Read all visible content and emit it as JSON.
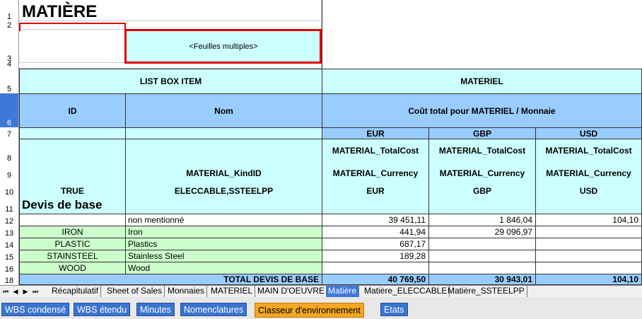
{
  "sheet": {
    "title": "MATIÈRE",
    "multi_sheets": "<Feuilles multiples>",
    "header_list_box": "LIST BOX ITEM",
    "header_materiel": "MATERIEL",
    "col_id": "ID",
    "col_nom": "Nom",
    "col_cost": "Coût total pour MATERIEL / Monnaie",
    "currencies": [
      "EUR",
      "GBP",
      "USD"
    ],
    "row8_fields": [
      "MATERIAL_TotalCost",
      "MATERIAL_TotalCost",
      "MATERIAL_TotalCost"
    ],
    "row9_kind": "MATERIAL_KindID",
    "row9_fields": [
      "MATERIAL_Currency",
      "MATERIAL_Currency",
      "MATERIAL_Currency"
    ],
    "row10": {
      "id": "TRUE",
      "nom": "ELECCABLE,SSTEELPP",
      "currencies": [
        "EUR",
        "GBP",
        "USD"
      ]
    },
    "section": "Devis de base",
    "rows": [
      {
        "id": "",
        "nom": "non mentionné",
        "eur": "39 451,11",
        "gbp": "1 846,04",
        "usd": "104,10"
      },
      {
        "id": "IRON",
        "nom": "Iron",
        "eur": "441,94",
        "gbp": "29 096,97",
        "usd": ""
      },
      {
        "id": "PLASTIC",
        "nom": "Plastics",
        "eur": "687,17",
        "gbp": "",
        "usd": ""
      },
      {
        "id": "STAINSTEEL",
        "nom": "Stainless Steel",
        "eur": "189,28",
        "gbp": "",
        "usd": ""
      },
      {
        "id": "WOOD",
        "nom": "Wood",
        "eur": "",
        "gbp": "",
        "usd": ""
      }
    ],
    "total": {
      "label": "TOTAL DEVIS DE BASE",
      "eur": "40 769,50",
      "gbp": "30 943,01",
      "usd": "104,10"
    },
    "row_numbers": [
      "1",
      "2",
      "3",
      "4",
      "5",
      "6",
      "7",
      "8",
      "9",
      "10",
      "11",
      "12",
      "13",
      "14",
      "15",
      "16",
      "18"
    ]
  },
  "sheet_tabs": {
    "nav": [
      "⏮",
      "◀",
      "▶",
      "⏭"
    ],
    "items": [
      "Récapitulatif",
      "Sheet of Sales",
      "Monnaies",
      "MATERIEL",
      "MAIN D'OEUVRE",
      "Matière",
      "Matière_ELECCABLE",
      "Matière_SSTEELPP"
    ],
    "active": "Matière"
  },
  "view_buttons": {
    "items": [
      "WBS condensé",
      "WBS étendu",
      "Minutes",
      "Nomenclatures",
      "Classeur d'environnement",
      "Etats"
    ],
    "active": "Classeur d'environnement"
  },
  "colors": {
    "cyan": "#ccffff",
    "blue": "#99ccff",
    "green": "#ccffcc",
    "selection": "#e00000",
    "active_tab": "#3f78d8",
    "active_button": "#f5a623"
  }
}
